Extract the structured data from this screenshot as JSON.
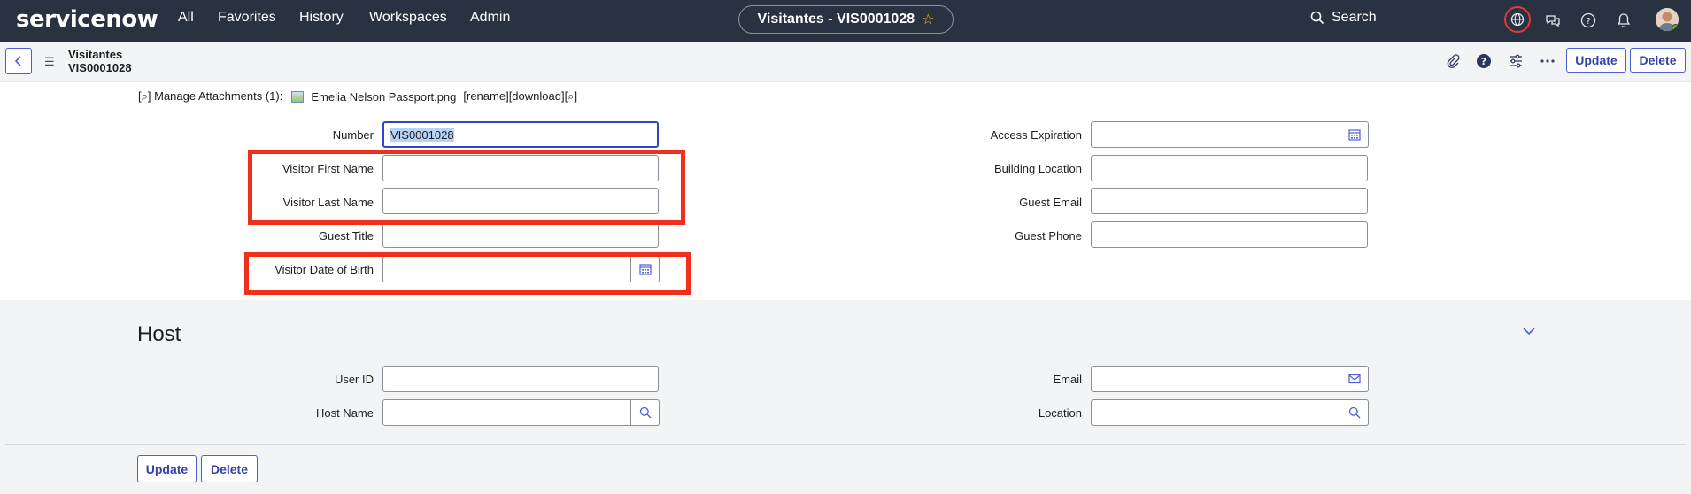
{
  "topnav": {
    "logo": "servicenow",
    "items": [
      "All",
      "Favorites",
      "History",
      "Workspaces",
      "Admin"
    ],
    "record_title": "Visitantes - VIS0001028",
    "search_label": "Search"
  },
  "formbar": {
    "table_name": "Visitantes",
    "record_number": "VIS0001028",
    "update_label": "Update",
    "delete_label": "Delete"
  },
  "attachments": {
    "prefix": "[⌕] Manage Attachments (1):",
    "file_name": "Emelia Nelson Passport.png",
    "actions": "[rename][download][⌕]"
  },
  "fields_left": [
    {
      "label": "Number",
      "value": "VIS0001028"
    },
    {
      "label": "Visitor First Name",
      "value": ""
    },
    {
      "label": "Visitor Last Name",
      "value": ""
    },
    {
      "label": "Guest Title",
      "value": ""
    },
    {
      "label": "Visitor Date of Birth",
      "value": ""
    }
  ],
  "fields_right": [
    {
      "label": "Access Expiration",
      "value": ""
    },
    {
      "label": "Building Location",
      "value": ""
    },
    {
      "label": "Guest Email",
      "value": ""
    },
    {
      "label": "Guest Phone",
      "value": ""
    }
  ],
  "host": {
    "title": "Host",
    "fields_left": [
      {
        "label": "User ID",
        "value": ""
      },
      {
        "label": "Host Name",
        "value": ""
      }
    ],
    "fields_right": [
      {
        "label": "Email",
        "value": ""
      },
      {
        "label": "Location",
        "value": ""
      }
    ]
  },
  "footer": {
    "update_label": "Update",
    "delete_label": "Delete"
  },
  "colors": {
    "nav_bg": "#293241",
    "accent": "#4c5fd6",
    "highlight": "#f0301d"
  }
}
